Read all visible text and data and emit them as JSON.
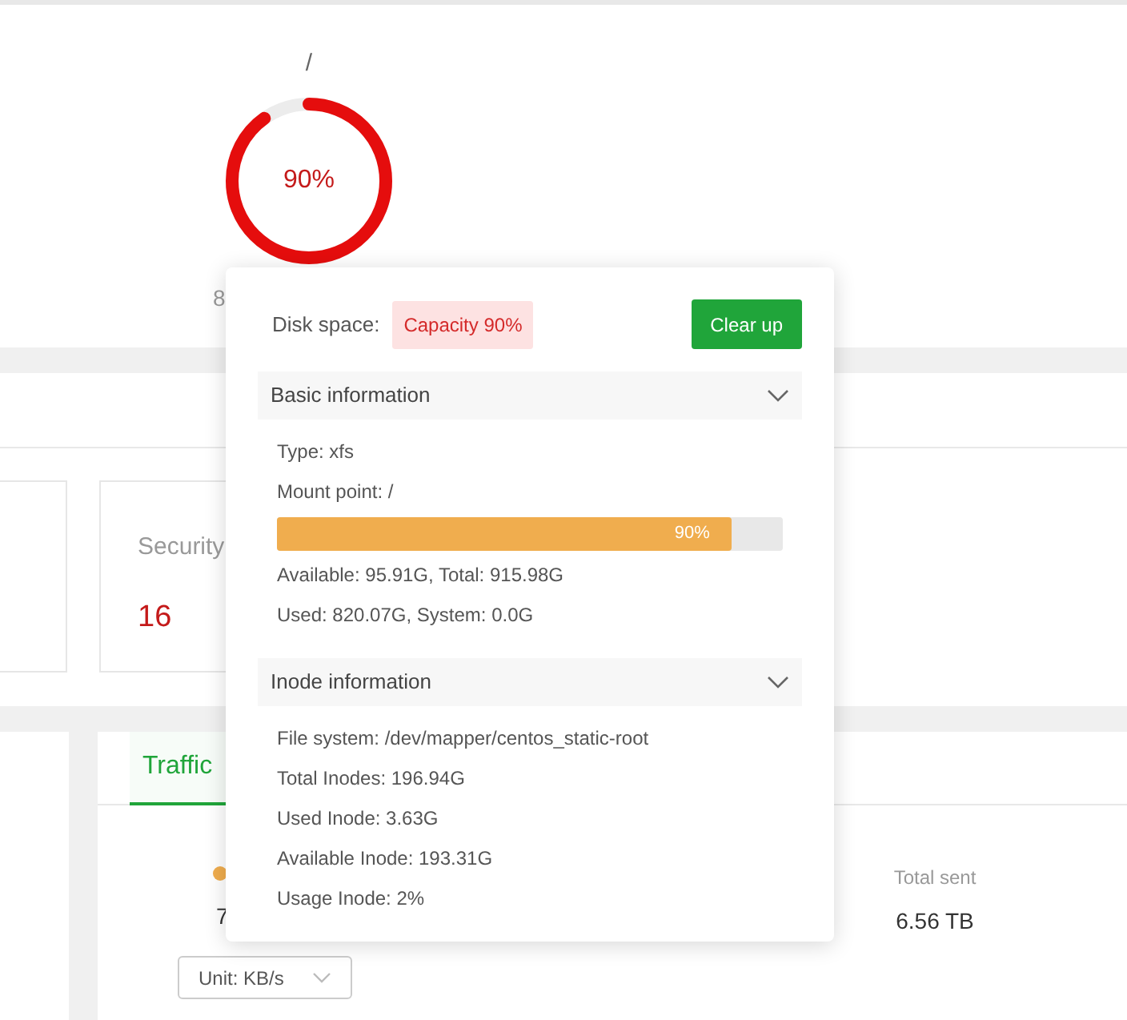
{
  "disk_card": {
    "mount_label": "/",
    "usage_label": "90%",
    "level": 0.9,
    "caption": "8"
  },
  "security_card": {
    "label": "Security",
    "count": "16"
  },
  "traffic_panel": {
    "tabs": [
      {
        "label": "Traffic",
        "selected": true
      }
    ],
    "legend_value": "7",
    "total_sent": {
      "label": "Total sent",
      "value": "6.56 TB"
    },
    "unit_select": {
      "value": "Unit: KB/s"
    }
  },
  "popover": {
    "title": "Disk space:",
    "badge": "Capacity 90%",
    "button": "Clear up",
    "sections": [
      {
        "title": "Basic information",
        "expanded": true,
        "rows": [
          {
            "kind": "text",
            "text": "Type: xfs"
          },
          {
            "kind": "text",
            "text": "Mount point: /"
          },
          {
            "kind": "bar",
            "level": 0.9,
            "reading": "90%"
          },
          {
            "kind": "text",
            "text": "Available: 95.91G, Total: 915.98G"
          },
          {
            "kind": "text",
            "text": "Used: 820.07G, System: 0.0G"
          }
        ]
      },
      {
        "title": "Inode information",
        "expanded": true,
        "rows": [
          {
            "kind": "text",
            "text": "File system: /dev/mapper/centos_static-root"
          },
          {
            "kind": "text",
            "text": "Total Inodes: 196.94G"
          },
          {
            "kind": "text",
            "text": "Used Inode: 3.63G"
          },
          {
            "kind": "text",
            "text": "Available Inode: 193.31G"
          },
          {
            "kind": "text",
            "text": "Usage Inode: 2%"
          }
        ]
      }
    ]
  }
}
